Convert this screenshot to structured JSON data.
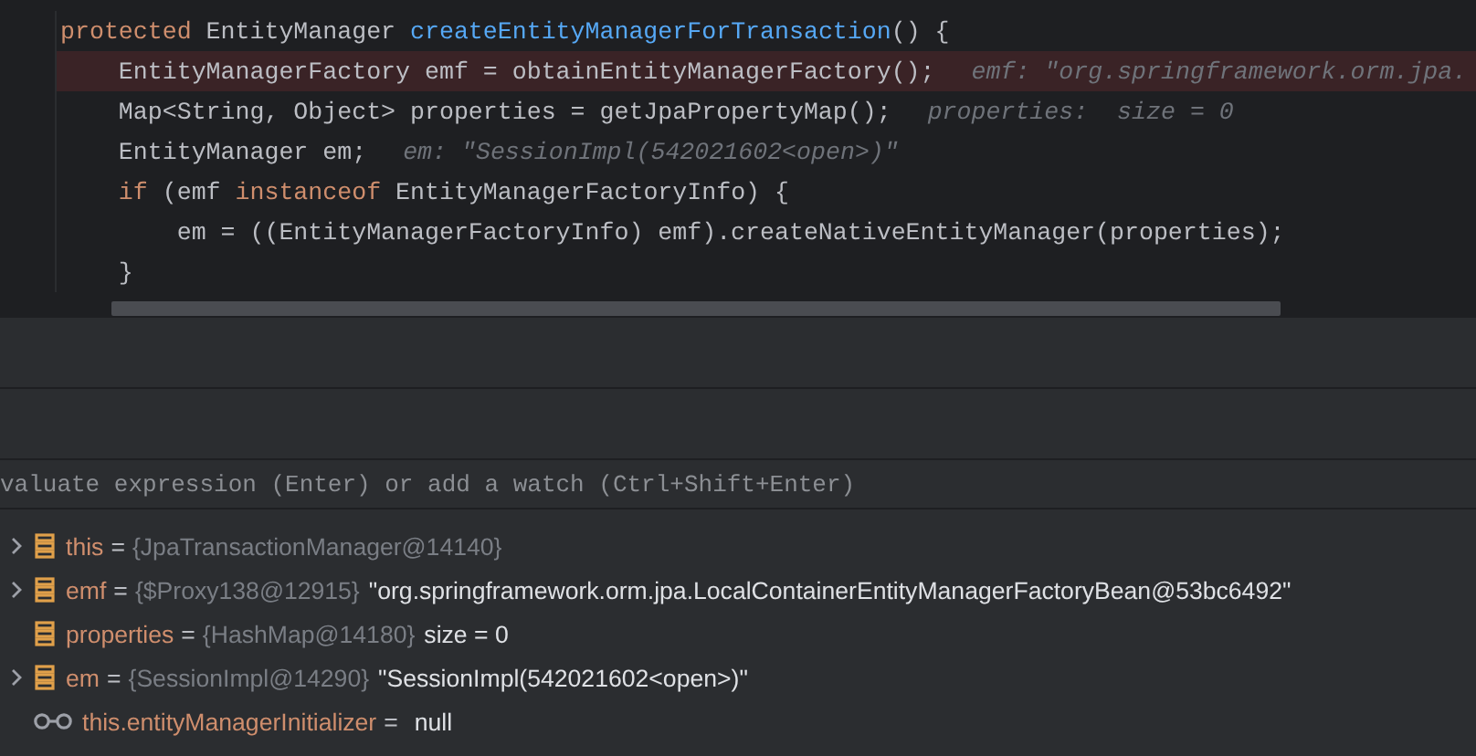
{
  "editor": {
    "lines": [
      {
        "highlighted": false,
        "tokens": [
          {
            "kind": "keyword",
            "text": "protected "
          },
          {
            "kind": "plain",
            "text": "EntityManager "
          },
          {
            "kind": "method",
            "text": "createEntityManagerForTransaction"
          },
          {
            "kind": "plain",
            "text": "() {"
          }
        ]
      },
      {
        "highlighted": true,
        "tokens": [
          {
            "kind": "plain",
            "text": "    EntityManagerFactory emf = obtainEntityManagerFactory();"
          }
        ],
        "hint": "emf: \"org.springframework.orm.jpa."
      },
      {
        "highlighted": false,
        "tokens": [
          {
            "kind": "plain",
            "text": "    Map<String, Object> properties = getJpaPropertyMap();"
          }
        ],
        "hint": "properties:  size = 0"
      },
      {
        "highlighted": false,
        "tokens": [
          {
            "kind": "plain",
            "text": "    EntityManager em;"
          }
        ],
        "hint": "em: \"SessionImpl(542021602<open>)\""
      },
      {
        "highlighted": false,
        "tokens": [
          {
            "kind": "keyword",
            "text": "    if "
          },
          {
            "kind": "plain",
            "text": "(emf "
          },
          {
            "kind": "keyword",
            "text": "instanceof "
          },
          {
            "kind": "plain",
            "text": "EntityManagerFactoryInfo) {"
          }
        ]
      },
      {
        "highlighted": false,
        "tokens": [
          {
            "kind": "plain",
            "text": "        em = ((EntityManagerFactoryInfo) emf).createNativeEntityManager(properties);"
          }
        ]
      },
      {
        "highlighted": false,
        "tokens": [
          {
            "kind": "plain",
            "text": "    }"
          }
        ]
      }
    ]
  },
  "evaluate": {
    "placeholder": "valuate expression (Enter) or add a watch (Ctrl+Shift+Enter)"
  },
  "variables": [
    {
      "kind": "field",
      "expandable": true,
      "name": "this",
      "eq": "=",
      "type": "{JpaTransactionManager@14140}"
    },
    {
      "kind": "field",
      "expandable": true,
      "name": "emf",
      "eq": "=",
      "type": "{$Proxy138@12915}",
      "value": "\"org.springframework.orm.jpa.LocalContainerEntityManagerFactoryBean@53bc6492\""
    },
    {
      "kind": "field",
      "expandable": false,
      "name": "properties",
      "eq": "=",
      "type": "{HashMap@14180}",
      "value": "size = 0"
    },
    {
      "kind": "field",
      "expandable": true,
      "name": "em",
      "eq": "=",
      "type": "{SessionImpl@14290}",
      "value": "\"SessionImpl(542021602<open>)\""
    },
    {
      "kind": "watch",
      "expandable": false,
      "name": "this.entityManagerInitializer",
      "eq": "=",
      "value": "null"
    }
  ]
}
